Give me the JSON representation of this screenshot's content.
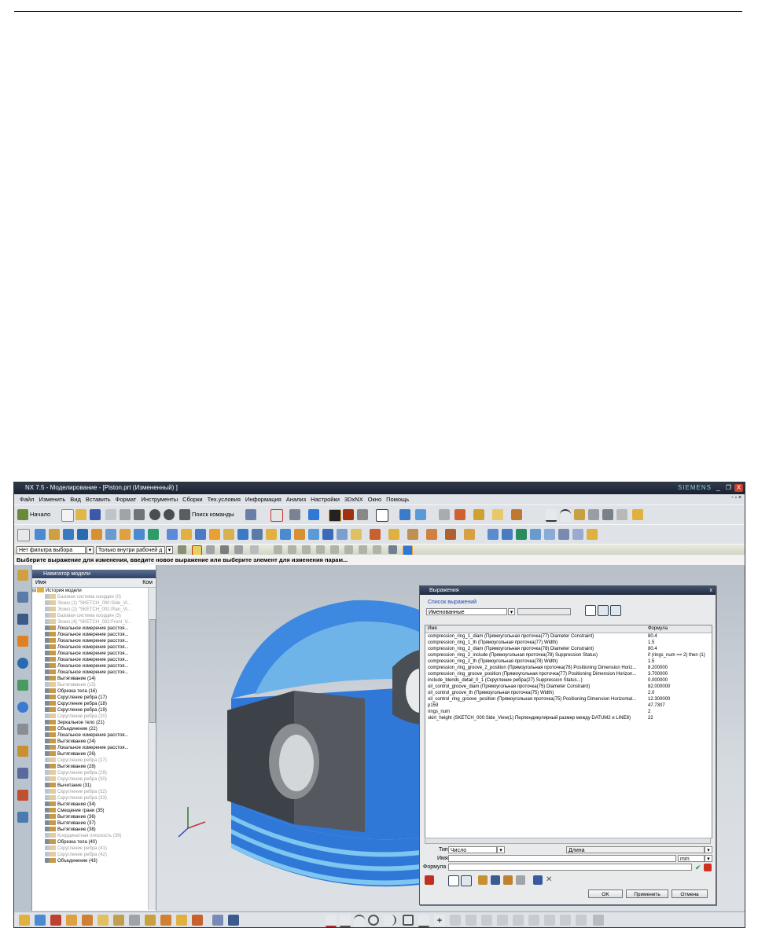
{
  "window": {
    "title": "NX 7.5 - Моделирование - [Piston.prt (Измененный) ]",
    "brand": "SIEMENS",
    "min": "_",
    "restore": "❐",
    "close": "X"
  },
  "menu": [
    "Файл",
    "Изменить",
    "Вид",
    "Вставить",
    "Формат",
    "Инструменты",
    "Сборки",
    "Тех.условия",
    "Информация",
    "Анализ",
    "Настройки",
    "3DxNX",
    "Окно",
    "Помощь"
  ],
  "toolbar": {
    "start_label": "Начало",
    "find_command": "Поиск команды"
  },
  "selection_bar": {
    "filter": "Нет фильтра выбора",
    "scope": "Только внутри рабочей д"
  },
  "cue_line": "Выберите выражение для изменения, введите новое выражение или выберите элемент для изменения парам...",
  "navigator": {
    "title": "Навигатор модели",
    "col_name": "Имя",
    "col_comment": "Ком",
    "root": "История модели",
    "items": [
      {
        "label": "Базовая система координ (0)",
        "dim": true
      },
      {
        "label": "Эскиз (1) \"SKETCH_000:Side_Vi...",
        "dim": true
      },
      {
        "label": "Эскиз (2) \"SKETCH_001:Plan_Vi...",
        "dim": true
      },
      {
        "label": "Базовая система координ (3)",
        "dim": true
      },
      {
        "label": "Эскиз (4) \"SKETCH_002:Front_V...",
        "dim": true
      },
      {
        "label": "Локальное измерение расстоя...",
        "dim": false
      },
      {
        "label": "Локальное измерение расстоя...",
        "dim": false
      },
      {
        "label": "Локальное измерение расстоя...",
        "dim": false
      },
      {
        "label": "Локальное измерение расстоя...",
        "dim": false
      },
      {
        "label": "Локальное измерение расстоя...",
        "dim": false
      },
      {
        "label": "Локальное измерение расстоя...",
        "dim": false
      },
      {
        "label": "Локальное измерение расстоя...",
        "dim": false
      },
      {
        "label": "Локальное измерение расстоя...",
        "dim": false
      },
      {
        "label": "Вытягивание (14)",
        "dim": false
      },
      {
        "label": "Вытягивание (15)",
        "dim": true
      },
      {
        "label": "Обрезка тела (16)",
        "dim": false
      },
      {
        "label": "Скругление ребра (17)",
        "dim": false
      },
      {
        "label": "Скругление ребра (18)",
        "dim": false
      },
      {
        "label": "Скругление ребра (19)",
        "dim": false
      },
      {
        "label": "Скругление ребра (20)",
        "dim": true
      },
      {
        "label": "Зеркальное тело (21)",
        "dim": false
      },
      {
        "label": "Объединение (22)",
        "dim": false
      },
      {
        "label": "Локальное измерение расстоя...",
        "dim": false
      },
      {
        "label": "Вытягивание (24)",
        "dim": false
      },
      {
        "label": "Локальное измерение расстоя...",
        "dim": false
      },
      {
        "label": "Вытягивание (26)",
        "dim": false
      },
      {
        "label": "Скругление ребра (27)",
        "dim": true
      },
      {
        "label": "Вытягивание (28)",
        "dim": false
      },
      {
        "label": "Скругление ребра (29)",
        "dim": true
      },
      {
        "label": "Скругление ребра (30)",
        "dim": true
      },
      {
        "label": "Вычитание (31)",
        "dim": false
      },
      {
        "label": "Скругление ребра (32)",
        "dim": true
      },
      {
        "label": "Скругление ребра (33)",
        "dim": true
      },
      {
        "label": "Вытягивание (34)",
        "dim": false
      },
      {
        "label": "Смещение грани (35)",
        "dim": false
      },
      {
        "label": "Вытягивание (36)",
        "dim": false
      },
      {
        "label": "Вытягивание (37)",
        "dim": false
      },
      {
        "label": "Вытягивание (38)",
        "dim": false
      },
      {
        "label": "Координатная плоскость (39)",
        "dim": true
      },
      {
        "label": "Обрезка тела (40)",
        "dim": false
      },
      {
        "label": "Скругление ребра (41)",
        "dim": true
      },
      {
        "label": "Скругление ребра (42)",
        "dim": true
      },
      {
        "label": "Объединение (43)",
        "dim": false
      }
    ]
  },
  "dialog": {
    "title": "Выражения",
    "close": "x",
    "list_label": "Список выражений",
    "list_value": "Именованные",
    "col_name": "Имя",
    "col_formula": "Формула",
    "rows": [
      {
        "name": "compression_ring_1_diam  (Прямоугольная проточка(77) Diameter Constraint)",
        "formula": "80.4"
      },
      {
        "name": "compression_ring_1_th  (Прямоугольная проточка(77) Width)",
        "formula": "1.5"
      },
      {
        "name": "compression_ring_2_diam  (Прямоугольная проточка(78) Diameter Constraint)",
        "formula": "80.4"
      },
      {
        "name": "compression_ring_2_include  (Прямоугольная проточка(78) Suppression Status)",
        "formula": "if (rings_num == 2) then (1)"
      },
      {
        "name": "compression_ring_2_th  (Прямоугольная проточка(78) Width)",
        "formula": "1.5"
      },
      {
        "name": "compression_ring_groove_2_position  (Прямоугольная проточка(78) Positioning Dimension Horiz...",
        "formula": "8.200000"
      },
      {
        "name": "compression_ring_groove_position  (Прямоугольная проточка(77) Positioning Dimension Horizon...",
        "formula": "3.700000"
      },
      {
        "name": "include_blends_detail_0_1  (Скругление ребра(27) Suppression Status...)",
        "formula": "0.000000"
      },
      {
        "name": "oil_control_groove_diam  (Прямоугольная проточка(75) Diameter Constraint)",
        "formula": "82.000000"
      },
      {
        "name": "oil_control_groove_th  (Прямоугольная проточка(75) Width)",
        "formula": "2.0"
      },
      {
        "name": "oil_control_ring_groove_position  (Прямоугольная проточка(75) Positioning Dimension Horizontal...",
        "formula": "12.300000"
      },
      {
        "name": "p159",
        "formula": "47.7307"
      },
      {
        "name": "rings_num",
        "formula": "2"
      },
      {
        "name": "skirt_height  (SKETCH_000:Side_View(1) Перпендикулярный размер между DATUM2 и LINE8)",
        "formula": "22"
      }
    ],
    "type_label": "Тип",
    "type_value": "Число",
    "unit_kind": "Длина",
    "name_label": "Имя",
    "unit_value": "mm",
    "formula_label": "Формула",
    "ok": "OK",
    "apply": "Применить",
    "cancel": "Отмена"
  },
  "colors": {
    "piston_blue": "#2f78d8",
    "piston_dark": "#3d4148",
    "highlight": "#7ec6f0"
  }
}
